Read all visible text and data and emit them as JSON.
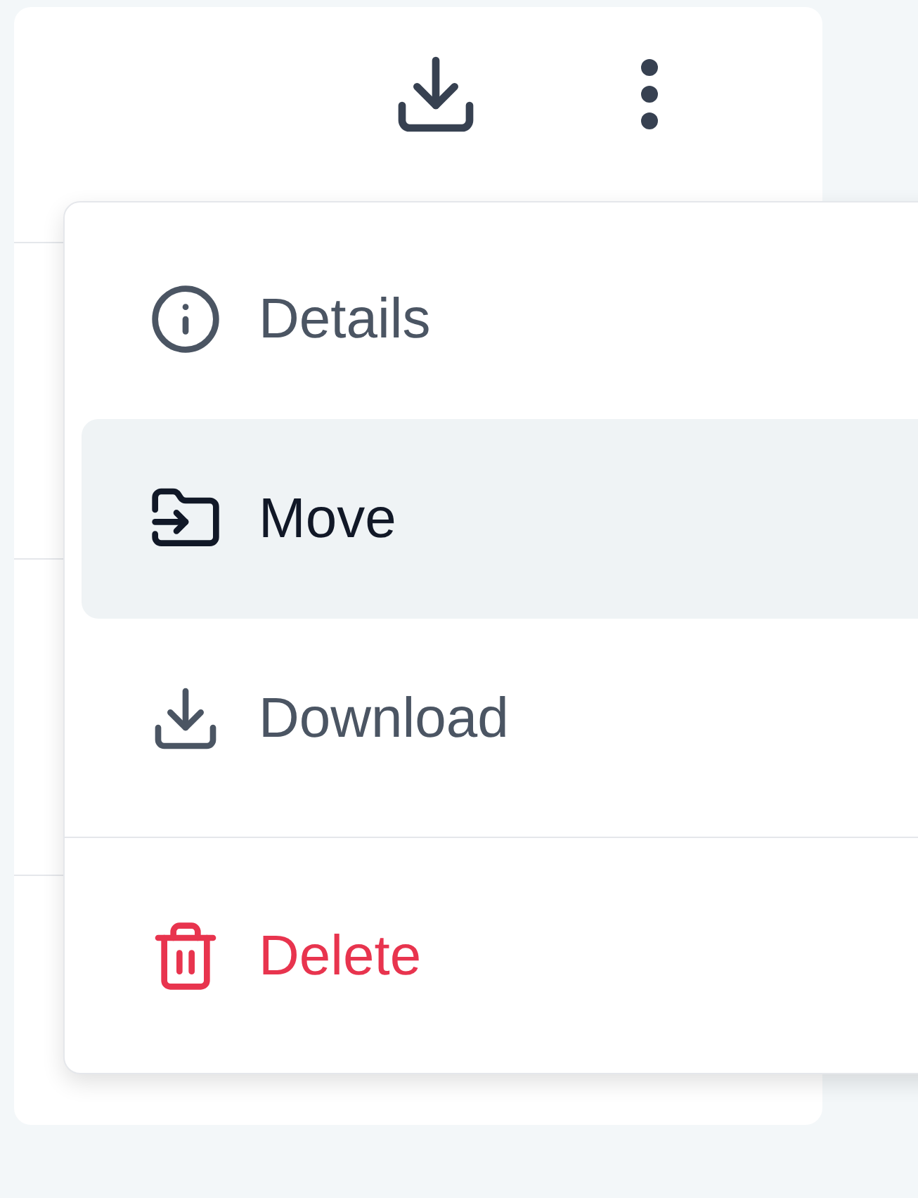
{
  "menu": {
    "items": [
      {
        "label": "Details",
        "kind": "info",
        "selected": false
      },
      {
        "label": "Move",
        "kind": "move",
        "selected": true
      },
      {
        "label": "Download",
        "kind": "download",
        "selected": false
      },
      {
        "label": "Delete",
        "kind": "delete",
        "selected": false
      }
    ]
  }
}
